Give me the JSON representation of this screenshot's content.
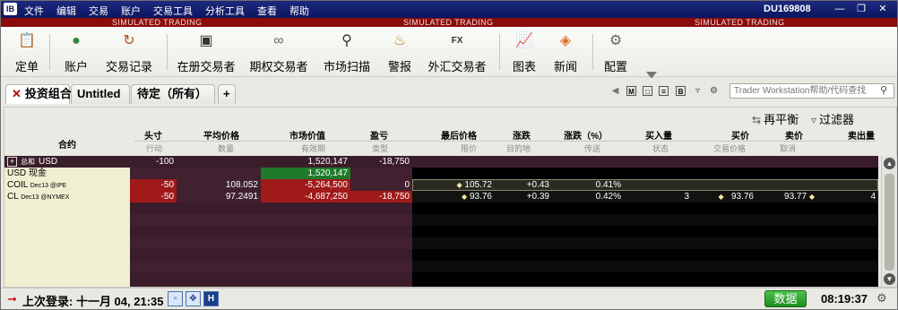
{
  "menubar": {
    "logo": "IB",
    "items": [
      "文件",
      "编辑",
      "交易",
      "账户",
      "交易工具",
      "分析工具",
      "查看",
      "帮助"
    ],
    "account": "DU169808",
    "window_controls": [
      "minimize-icon",
      "restore-icon",
      "close-icon"
    ]
  },
  "banner": [
    "SIMULATED TRADING",
    "SIMULATED TRADING",
    "SIMULATED TRADING"
  ],
  "toolbar": {
    "items": [
      {
        "label": "定单",
        "icon": "order-icon"
      },
      {
        "label": "账户",
        "icon": "account-icon"
      },
      {
        "label": "交易记录",
        "icon": "trades-icon"
      },
      {
        "label": "在册交易者",
        "icon": "book-trader-icon"
      },
      {
        "label": "期权交易者",
        "icon": "option-trader-icon"
      },
      {
        "label": "市场扫描",
        "icon": "scanner-icon"
      },
      {
        "label": "警报",
        "icon": "alert-bell-icon"
      },
      {
        "label": "外汇交易者",
        "icon": "fx-trader-icon"
      },
      {
        "label": "图表",
        "icon": "chart-icon"
      },
      {
        "label": "新闻",
        "icon": "rss-icon"
      },
      {
        "label": "配置",
        "icon": "wrench-icon"
      }
    ]
  },
  "tabs": [
    {
      "label": "投资组合"
    },
    {
      "label": "Untitled"
    },
    {
      "label": "待定（所有）"
    },
    {
      "label": "+"
    }
  ],
  "search": {
    "placeholder": "Trader Workstation帮助/代码查找"
  },
  "panel": {
    "rebalance": "再平衡",
    "filter": "过滤器"
  },
  "columns": {
    "contract": "合约",
    "position": [
      "头寸",
      "行动"
    ],
    "avg_price": [
      "平均价格",
      "数量"
    ],
    "market_value": [
      "市场价值",
      "有效期"
    ],
    "pnl": [
      "盈亏",
      "类型"
    ],
    "last": [
      "最后价格",
      "限价"
    ],
    "change": [
      "涨跌",
      "目的地"
    ],
    "change_pct": [
      "涨跌（%）",
      "传送"
    ],
    "bid_size": [
      "买入量",
      "状态"
    ],
    "bid": [
      "买价",
      "交易价格"
    ],
    "ask": [
      "卖价",
      "取消"
    ],
    "ask_size": [
      "卖出量",
      ""
    ]
  },
  "rows": [
    {
      "name": "USD",
      "expander": "+",
      "prefix": "总和",
      "position": "-100",
      "avg_price": "",
      "market_value": "1,520,147",
      "pnl": "-18,750"
    },
    {
      "name": "USD 现金",
      "position": "",
      "avg_price": "",
      "market_value": "1,520,147",
      "pnl": ""
    },
    {
      "name": "COIL",
      "sub": "Dec13 @IPE",
      "position": "-50",
      "avg_price": "108.052",
      "market_value": "-5,264,500",
      "pnl": "0",
      "last": "105.72",
      "change": "+0.43",
      "change_pct": "0.41%",
      "bid_size": "",
      "bid": "",
      "ask": "",
      "ask_size": ""
    },
    {
      "name": "CL",
      "sub": "Dec13 @NYMEX",
      "position": "-50",
      "avg_price": "97.2491",
      "market_value": "-4,687,250",
      "pnl": "-18,750",
      "last": "93.76",
      "change": "+0.39",
      "change_pct": "0.42%",
      "bid_size": "3",
      "bid": "93.76",
      "ask": "93.77",
      "ask_size": "4"
    }
  ],
  "status": {
    "last_login": "上次登录: 十一月 04, 21:35",
    "data_button": "数据",
    "clock": "08:19:37"
  }
}
